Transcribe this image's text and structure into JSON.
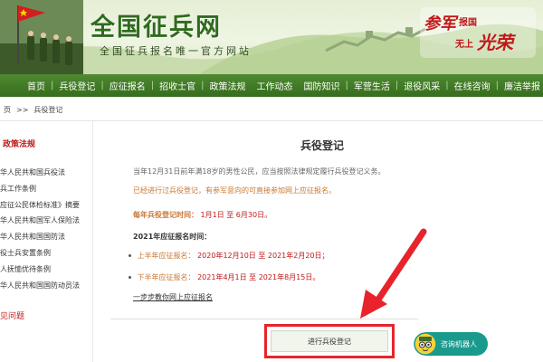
{
  "header": {
    "site_title": "全国征兵网",
    "site_subtitle": "全国征兵报名唯一官方网站",
    "slogan_1": "参军",
    "slogan_2": "报国",
    "slogan_3": "无上",
    "slogan_4": "光荣"
  },
  "nav": {
    "items": [
      "首页",
      "兵役登记",
      "应征报名",
      "招收士官",
      "政策法规",
      "工作动态",
      "国防知识",
      "军营生活",
      "退役风采",
      "在线咨询",
      "廉洁举报"
    ]
  },
  "breadcrumb": {
    "home": "页",
    "separator": ">>",
    "current": "兵役登记"
  },
  "sidebar": {
    "title": "政策法规",
    "items": [
      "华人民共和国兵役法",
      "兵工作条例",
      "应征公民体检标准》摘要",
      "华人民共和国军人保险法",
      "华人民共和国国防法",
      "役士兵安置条例",
      "人抚恤优待条例",
      "华人民共和国国防动员法"
    ],
    "faq": "见问题"
  },
  "main": {
    "title": "兵役登记",
    "intro": "当年12月31日前年满18岁的男性公民，应当按照法律规定履行兵役登记义务。",
    "notice": "已经进行过兵役登记，有参军意向的可直接参加网上应征报名。",
    "annual_label": "每年兵役登记时间：",
    "annual_value": "1月1日 至 6月30日。",
    "year_heading": "2021年应征报名时间：",
    "first_half_label": "上半年应征报名：",
    "first_half_value": "2020年12月10日 至 2021年2月20日；",
    "second_half_label": "下半年应征报名：",
    "second_half_value": "2021年4月1日 至 2021年8月15日。",
    "guide_link": "一步步教你网上应征报名",
    "register_button": "进行兵役登记",
    "robot_button": "咨询机器人"
  },
  "colors": {
    "brand_green": "#356d1c",
    "accent_red": "#c0191a",
    "highlight_border": "#e8232b",
    "orange_text": "#c87832",
    "robot_teal": "#1a9a8c"
  }
}
